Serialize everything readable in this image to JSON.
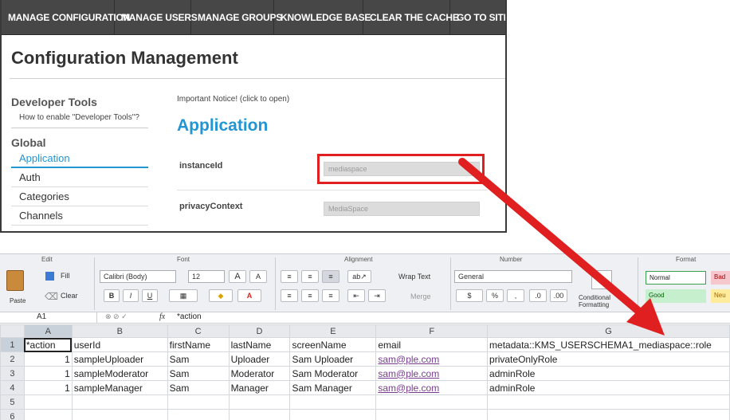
{
  "nav": {
    "items": [
      "MANAGE CONFIGURATION",
      "MANAGE USERS",
      "MANAGE GROUPS",
      "KNOWLEDGE BASE",
      "CLEAR THE CACHE",
      "GO TO SITE"
    ]
  },
  "admin": {
    "title": "Configuration Management",
    "sidebar": {
      "dev_heading": "Developer Tools",
      "dev_sub": "How to enable \"Developer Tools\"?",
      "global_heading": "Global",
      "links": [
        "Application",
        "Auth",
        "Categories",
        "Channels"
      ]
    },
    "notice": "Important Notice! (click to open)",
    "section_title": "Application",
    "fields": [
      {
        "label": "instanceId",
        "value": "mediaspace"
      },
      {
        "label": "privacyContext",
        "value": "MediaSpace"
      }
    ]
  },
  "ribbon": {
    "groups": {
      "edit": "Edit",
      "font": "Font",
      "alignment": "Alignment",
      "number": "Number",
      "format": "Format"
    },
    "paste": "Paste",
    "fill": "Fill",
    "clear": "Clear",
    "font_name": "Calibri (Body)",
    "font_size": "12",
    "bold": "B",
    "italic": "I",
    "underline": "U",
    "font_grow": "A",
    "font_shrink": "A",
    "wrap_text": "Wrap Text",
    "merge": "Merge",
    "number_format": "General",
    "percent": "%",
    "comma": ",",
    "conditional": "Conditional Formatting",
    "styles": {
      "normal": "Normal",
      "good": "Good",
      "bad": "Bad",
      "neutral": "Neu"
    }
  },
  "formula_bar": {
    "cell": "A1",
    "fx": "fx",
    "content": "*action"
  },
  "sheet": {
    "columns": [
      "A",
      "B",
      "C",
      "D",
      "E",
      "F",
      "G"
    ],
    "rows": [
      [
        "*action",
        "userId",
        "firstName",
        "lastName",
        "screenName",
        "email",
        "metadata::KMS_USERSCHEMA1_mediaspace::role"
      ],
      [
        "1",
        "sampleUploader",
        "Sam",
        "Uploader",
        "Sam Uploader",
        "sam@ple.com",
        "privateOnlyRole"
      ],
      [
        "1",
        "sampleModerator",
        "Sam",
        "Moderator",
        "Sam Moderator",
        "sam@ple.com",
        "adminRole"
      ],
      [
        "1",
        "sampleManager",
        "Sam",
        "Manager",
        "Sam Manager",
        "sam@ple.com",
        "adminRole"
      ],
      [
        "",
        "",
        "",
        "",
        "",
        "",
        ""
      ],
      [
        "",
        "",
        "",
        "",
        "",
        "",
        ""
      ]
    ]
  },
  "colors": {
    "accent": "#2196d3",
    "arrow": "#e02020",
    "nav_bg": "#474747"
  }
}
